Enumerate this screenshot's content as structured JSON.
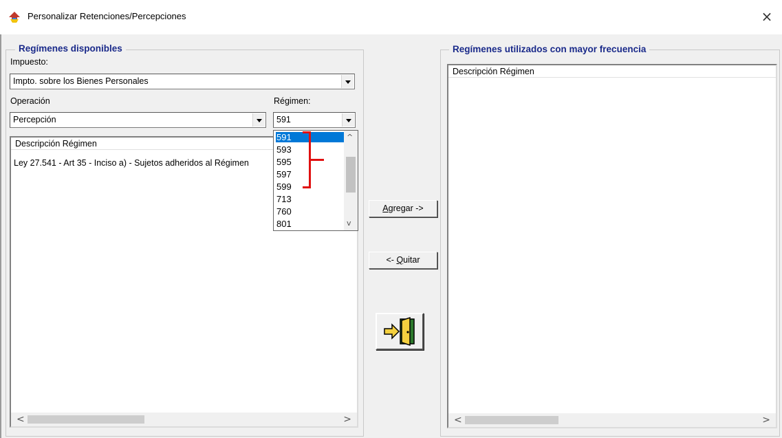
{
  "window": {
    "title": "Personalizar Retenciones/Percepciones",
    "close_glyph": "×",
    "app_icon": "app-logo-icon"
  },
  "left_group": {
    "title": "Regímenes disponibles",
    "impuesto_label": "Impuesto:",
    "impuesto_value": "Impto. sobre los Bienes Personales",
    "operacion_label": "Operación",
    "operacion_value": "Percepción",
    "regimen_label": "Régimen:",
    "regimen_value": "591",
    "list_header": "Descripción Régimen",
    "list_rows": [
      "Ley 27.541 - Art 35 - Inciso a) - Sujetos adheridos al Régimen"
    ]
  },
  "regimen_dropdown": {
    "options": [
      "591",
      "593",
      "595",
      "597",
      "599",
      "713",
      "760",
      "801"
    ],
    "selected": "591",
    "annotation_color": "#e01010"
  },
  "buttons": {
    "agregar_prefix": "",
    "agregar_underlined": "A",
    "agregar_rest": "gregar ->",
    "quitar_prefix": "<- ",
    "quitar_underlined": "Q",
    "quitar_rest": "uitar",
    "exit_icon": "exit-door-icon"
  },
  "right_group": {
    "title": "Regímenes utilizados con mayor frecuencia",
    "list_header": "Descripción Régimen"
  },
  "scroll_glyphs": {
    "left": "<",
    "right": ">",
    "up": "^",
    "down": "v"
  },
  "colors": {
    "group_title": "#1a2a8a",
    "selection": "#0078d7",
    "annotation": "#e01010"
  }
}
